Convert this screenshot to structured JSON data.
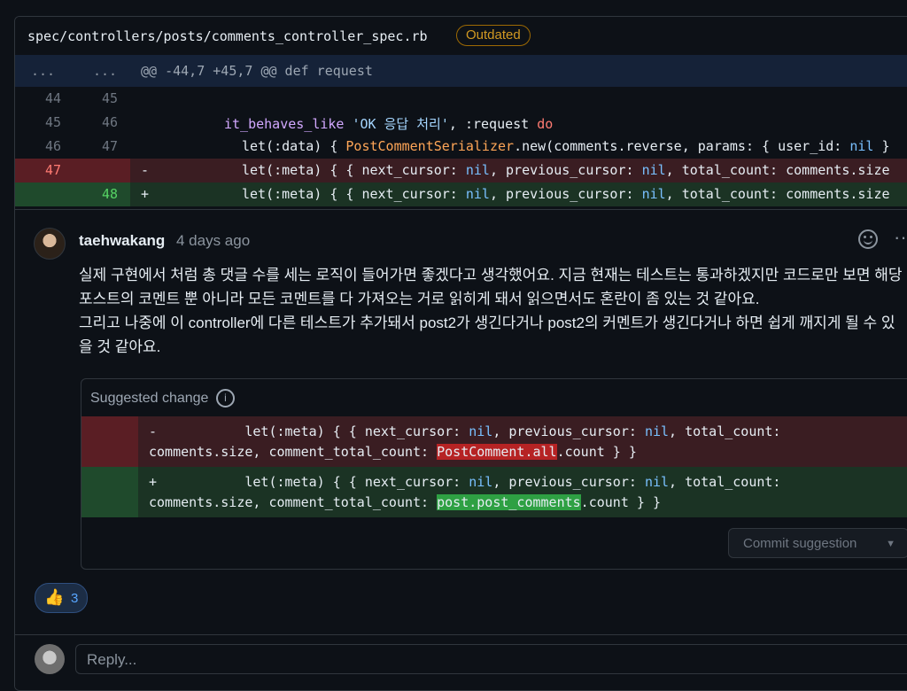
{
  "file": {
    "path": "spec/controllers/posts/comments_controller_spec.rb",
    "badge": "Outdated"
  },
  "hunk": {
    "left_dots": "...",
    "right_dots": "...",
    "header": "@@ -44,7 +45,7 @@ def request"
  },
  "diff": {
    "r1": {
      "old": "44",
      "new": "45"
    },
    "r2": {
      "old": "45",
      "new": "46",
      "a": "it_behaves_like ",
      "b": "'OK 응답 처리'",
      "c": ", :request ",
      "d": "do"
    },
    "r3": {
      "old": "46",
      "new": "47",
      "a": "let(:data) { ",
      "b": "PostCommentSerializer",
      "c": ".new(comments.reverse, params: { user_id: ",
      "d": "nil",
      "e": " }"
    },
    "r4": {
      "old": "47",
      "sign": "-",
      "a": "let(:meta) { { next_cursor: ",
      "b": "nil",
      "c": ", previous_cursor: ",
      "d": "nil",
      "e": ", total_count: comments.size"
    },
    "r5": {
      "new": "48",
      "sign": "+",
      "a": "let(:meta) { { next_cursor: ",
      "b": "nil",
      "c": ", previous_cursor: ",
      "d": "nil",
      "e": ", total_count: comments.size"
    }
  },
  "comment": {
    "author": "taehwakang",
    "time": "4 days ago",
    "lines": [
      "실제 구현에서 처럼 총 댓글 수를 세는 로직이 들어가면 좋겠다고 생각했어요. 지금 현재는 테스트는 통과하겠지만 코드로만 보면 해당",
      "포스트의 코멘트 뿐 아니라 모든 코멘트를 다 가져오는 거로 읽히게 돼서 읽으면서도 혼란이 좀 있는 것 같아요.",
      "그리고 나중에 이 controller에 다른 테스트가 추가돼서 post2가 생긴다거나 post2의 커멘트가 생긴다거나 하면 쉽게 깨지게 될 수 있",
      "을 것 같아요."
    ]
  },
  "suggestion": {
    "title": "Suggested change",
    "del": {
      "sign": "-",
      "l1a": "let(:meta) { { next_cursor: ",
      "l1b": "nil",
      "l1c": ", previous_cursor: ",
      "l1d": "nil",
      "l1e": ", total_count:",
      "l2a": "comments.size, comment_total_count: ",
      "l2b": "PostComment.all",
      "l2c": ".count } }"
    },
    "add": {
      "sign": "+",
      "l1a": "let(:meta) { { next_cursor: ",
      "l1b": "nil",
      "l1c": ", previous_cursor: ",
      "l1d": "nil",
      "l1e": ", total_count:",
      "l2a": "comments.size, comment_total_count: ",
      "l2b": "post.post_comments",
      "l2c": ".count } }"
    },
    "commit_label": "Commit suggestion"
  },
  "reaction": {
    "emoji": "👍",
    "count": "3"
  },
  "reply": {
    "placeholder": "Reply..."
  }
}
